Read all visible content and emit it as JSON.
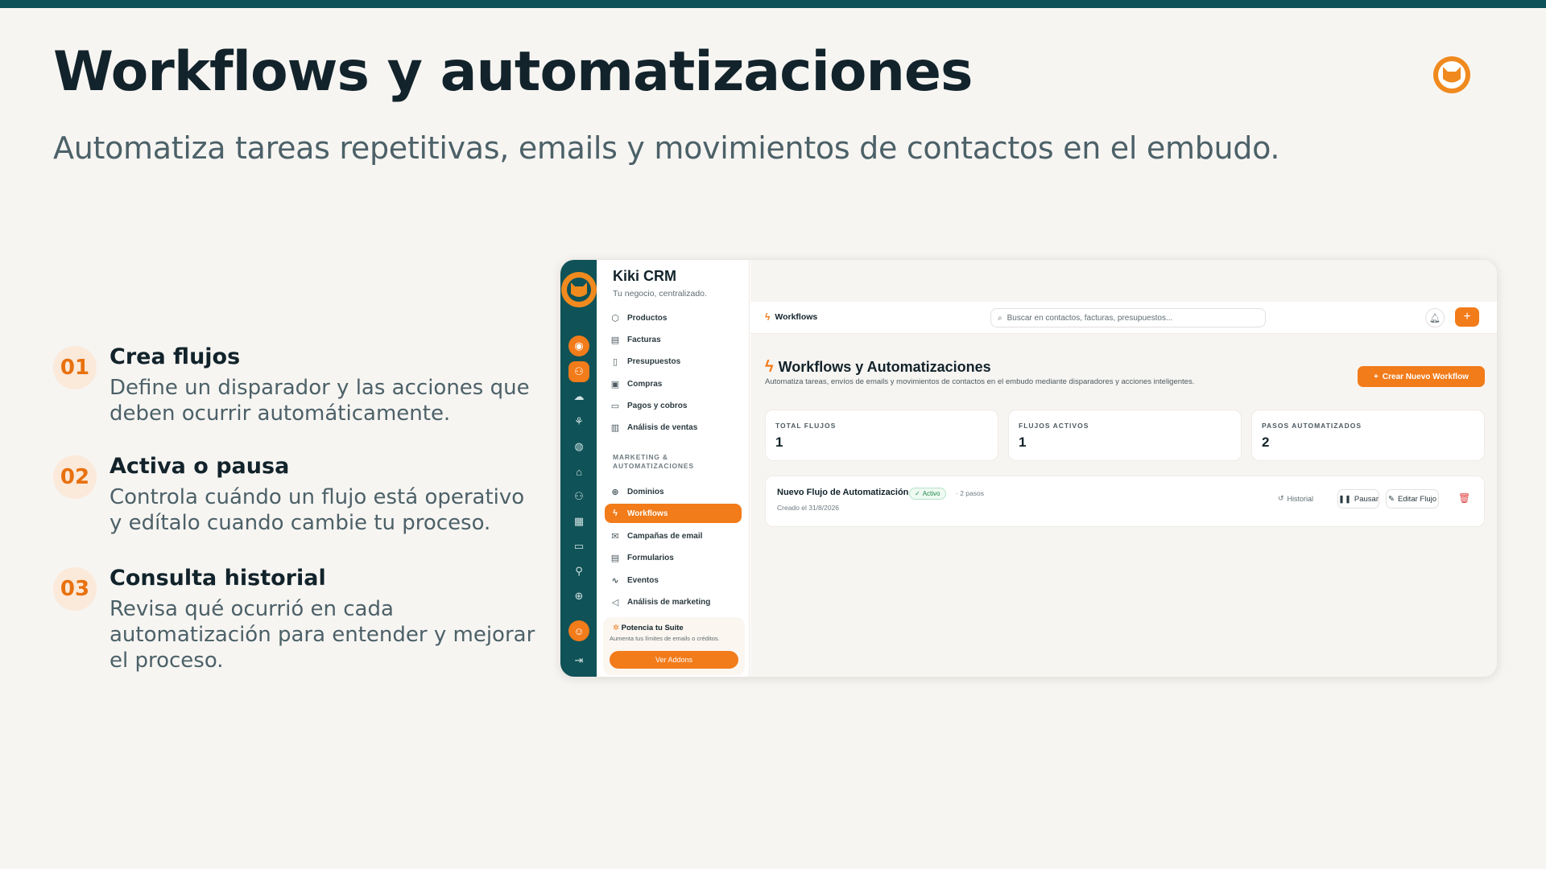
{
  "slide": {
    "title": "Workflows y automatizaciones",
    "subtitle": "Automatiza tareas repetitivas, emails y movimientos de contactos en el embudo."
  },
  "steps": [
    {
      "num": "01",
      "title": "Crea flujos",
      "desc": "Define un disparador y las acciones que deben ocurrir automáticamente."
    },
    {
      "num": "02",
      "title": "Activa o pausa",
      "desc": "Controla cuándo un flujo está operativo y edítalo cuando cambie tu proceso."
    },
    {
      "num": "03",
      "title": "Consulta historial",
      "desc": "Revisa qué ocurrió en cada automatización para entender y mejorar el proceso."
    }
  ],
  "app": {
    "name": "Kiki CRM",
    "tagline": "Tu negocio, centralizado.",
    "sidebar": {
      "items": [
        {
          "label": "Productos",
          "icon": "box-icon"
        },
        {
          "label": "Facturas",
          "icon": "file-icon"
        },
        {
          "label": "Presupuestos",
          "icon": "document-icon"
        },
        {
          "label": "Compras",
          "icon": "calendar-icon"
        },
        {
          "label": "Pagos y cobros",
          "icon": "card-icon"
        },
        {
          "label": "Análisis de ventas",
          "icon": "chart-icon"
        }
      ],
      "section": "MARKETING & AUTOMATIZACIONES",
      "marketing_items": [
        {
          "label": "Dominios",
          "icon": "globe-icon"
        },
        {
          "label": "Workflows",
          "icon": "bolt-icon",
          "active": true
        },
        {
          "label": "Campañas de email",
          "icon": "mail-icon"
        },
        {
          "label": "Formularios",
          "icon": "form-icon"
        },
        {
          "label": "Eventos",
          "icon": "pulse-icon"
        },
        {
          "label": "Análisis de marketing",
          "icon": "megaphone-icon"
        }
      ],
      "promo": {
        "title": "Potencia tu Suite",
        "text": "Aumenta tus límites de emails o créditos.",
        "button": "Ver Addons"
      }
    },
    "topbar": {
      "breadcrumb": "Workflows",
      "search_placeholder": "Buscar en contactos, facturas, presupuestos..."
    },
    "page": {
      "title": "Workflows y Automatizaciones",
      "description": "Automatiza tareas, envíos de emails y movimientos de contactos en el embudo mediante disparadores y acciones inteligentes.",
      "create_button": "Crear Nuevo Workflow"
    },
    "stats": [
      {
        "label": "TOTAL FLUJOS",
        "value": "1"
      },
      {
        "label": "FLUJOS ACTIVOS",
        "value": "1"
      },
      {
        "label": "PASOS AUTOMATIZADOS",
        "value": "2"
      }
    ],
    "workflow": {
      "name": "Nuevo Flujo de Automatización",
      "status": "Activo",
      "steps": "· 2 pasos",
      "created": "Creado el 31/8/2026",
      "history": "Historial",
      "pause": "Pausar",
      "edit": "Editar Flujo"
    }
  },
  "colors": {
    "accent": "#f27b1a",
    "teal": "#0f5257",
    "background": "#f7f5f2"
  }
}
